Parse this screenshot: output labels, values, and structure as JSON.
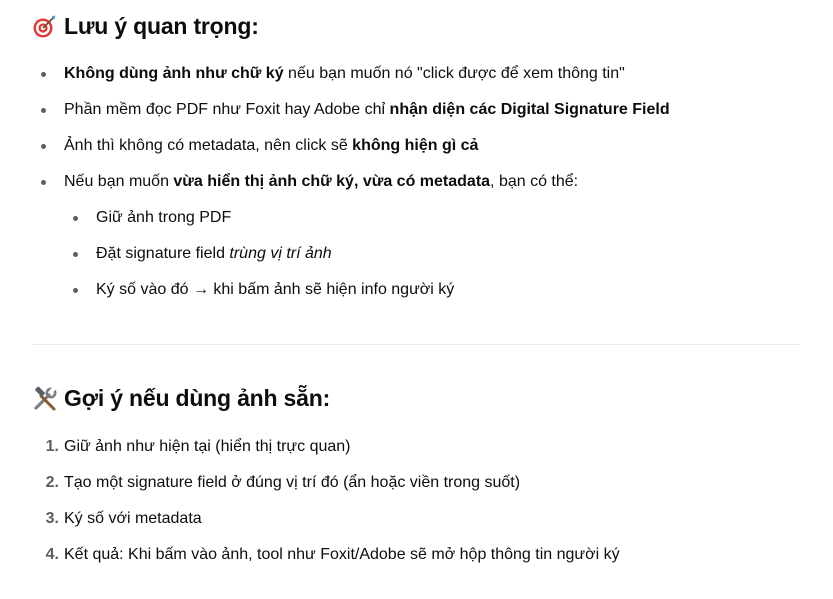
{
  "section1": {
    "icon": "target-icon",
    "title": "Lưu ý quan trọng:",
    "bullets": [
      {
        "b": "Không dùng ảnh như chữ ký",
        "t": " nếu bạn muốn nó \"click được để xem thông tin\""
      },
      {
        "t": "Phần mềm đọc PDF như Foxit hay Adobe chỉ ",
        "b": "nhận diện các Digital Signature Field"
      },
      {
        "t": "Ảnh thì không có metadata, nên click sẽ ",
        "b": "không hiện gì cả"
      },
      {
        "t1": "Nếu bạn muốn ",
        "b": "vừa hiển thị ảnh chữ ký, vừa có metadata",
        "t2": ", bạn có thể:"
      }
    ],
    "sub_bullets": [
      {
        "t": "Giữ ảnh trong PDF"
      },
      {
        "t": "Đặt signature field ",
        "i": "trùng vị trí ảnh"
      },
      {
        "t": "Ký số vào đó → khi bấm ảnh sẽ hiện info người ký"
      }
    ]
  },
  "section2": {
    "icon": "tools-icon",
    "title": "Gợi ý nếu dùng ảnh sẵn:",
    "items": [
      {
        "n": "1.",
        "t": "Giữ ảnh như hiện tại (hiển thị trực quan)"
      },
      {
        "n": "2.",
        "t": "Tạo một signature field ở đúng vị trí đó (ẩn hoặc viền trong suốt)"
      },
      {
        "n": "3.",
        "t": "Ký số với metadata"
      },
      {
        "n": "4.",
        "t": "Kết quả: Khi bấm vào ảnh, tool như Foxit/Adobe sẽ mở hộp thông tin người ký"
      }
    ]
  }
}
